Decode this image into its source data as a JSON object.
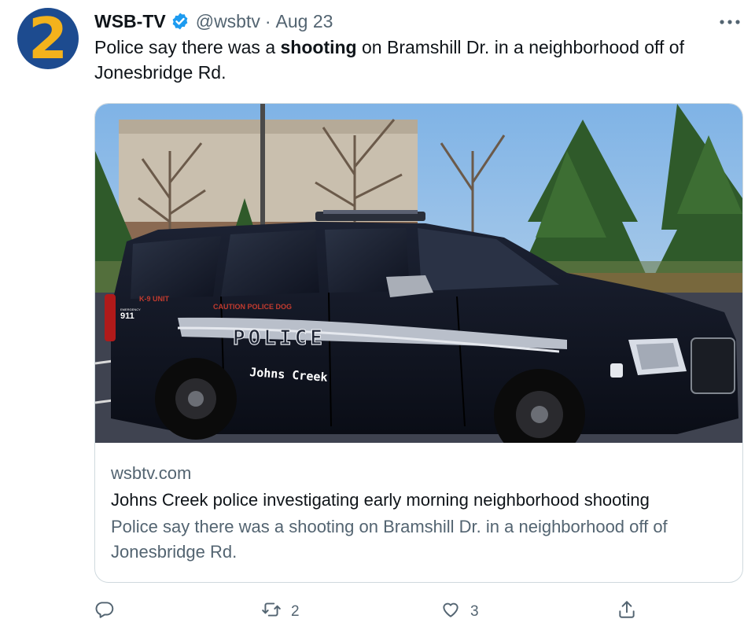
{
  "account": {
    "name": "WSB-TV",
    "handle": "@wsbtv",
    "separator": "·",
    "date": "Aug 23",
    "avatar_text": "2"
  },
  "tweet": {
    "text_before": "Police say there was a ",
    "text_bold": "shooting",
    "text_after": " on Bramshill Dr. in a neighborhood off of Jonesbridge Rd."
  },
  "card": {
    "image_text": {
      "unit": "K-9 UNIT",
      "emergency_label": "EMERGENCY",
      "emergency": "911",
      "caution": "CAUTION POLICE DOG",
      "police": "POLICE",
      "city": "Johns Creek"
    },
    "domain": "wsbtv.com",
    "title": "Johns Creek police investigating early morning neighborhood shooting",
    "description": "Police say there was a shooting on Bramshill Dr. in a neighborhood off of Jonesbridge Rd."
  },
  "actions": {
    "reply_count": "",
    "retweet_count": "2",
    "like_count": "3"
  },
  "icons": [
    "verified-badge-icon",
    "more-options-icon",
    "reply-icon",
    "retweet-icon",
    "like-icon",
    "share-icon"
  ],
  "colors": {
    "verified": "#1d9bf0",
    "avatar_bg": "#1d4b8f",
    "avatar_fg": "#f3b21c",
    "secondary_text": "#536471"
  }
}
